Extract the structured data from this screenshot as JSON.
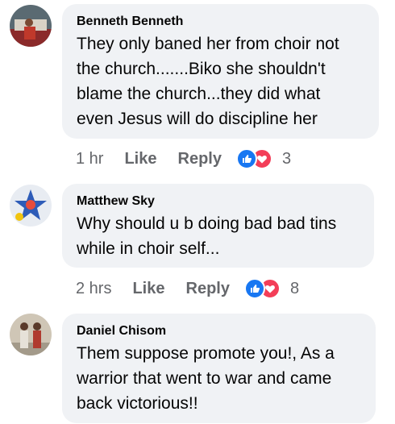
{
  "comments": [
    {
      "author": "Benneth Benneth",
      "lines": [
        "They only baned her from choir not",
        "the church.......Biko she shouldn't",
        "blame the church...they did what",
        "even Jesus will do discipline her"
      ],
      "time": "1 hr",
      "like_label": "Like",
      "reply_label": "Reply",
      "reaction_count": "3",
      "avatar_icon": "user-photo-avatar"
    },
    {
      "author": "Matthew Sky",
      "lines": [
        "Why should u b doing bad bad tins",
        "while in choir self..."
      ],
      "time": "2 hrs",
      "like_label": "Like",
      "reply_label": "Reply",
      "reaction_count": "8",
      "avatar_icon": "user-photo-avatar"
    },
    {
      "author": "Daniel Chisom",
      "lines": [
        "Them suppose promote you!, As a",
        "warrior that went to war and came",
        "back victorious!!"
      ],
      "avatar_icon": "user-photo-avatar"
    }
  ],
  "colors": {
    "bubble": "#f0f2f5",
    "like": "#1877f2",
    "love": "#f33e58",
    "meta": "#65676b"
  }
}
